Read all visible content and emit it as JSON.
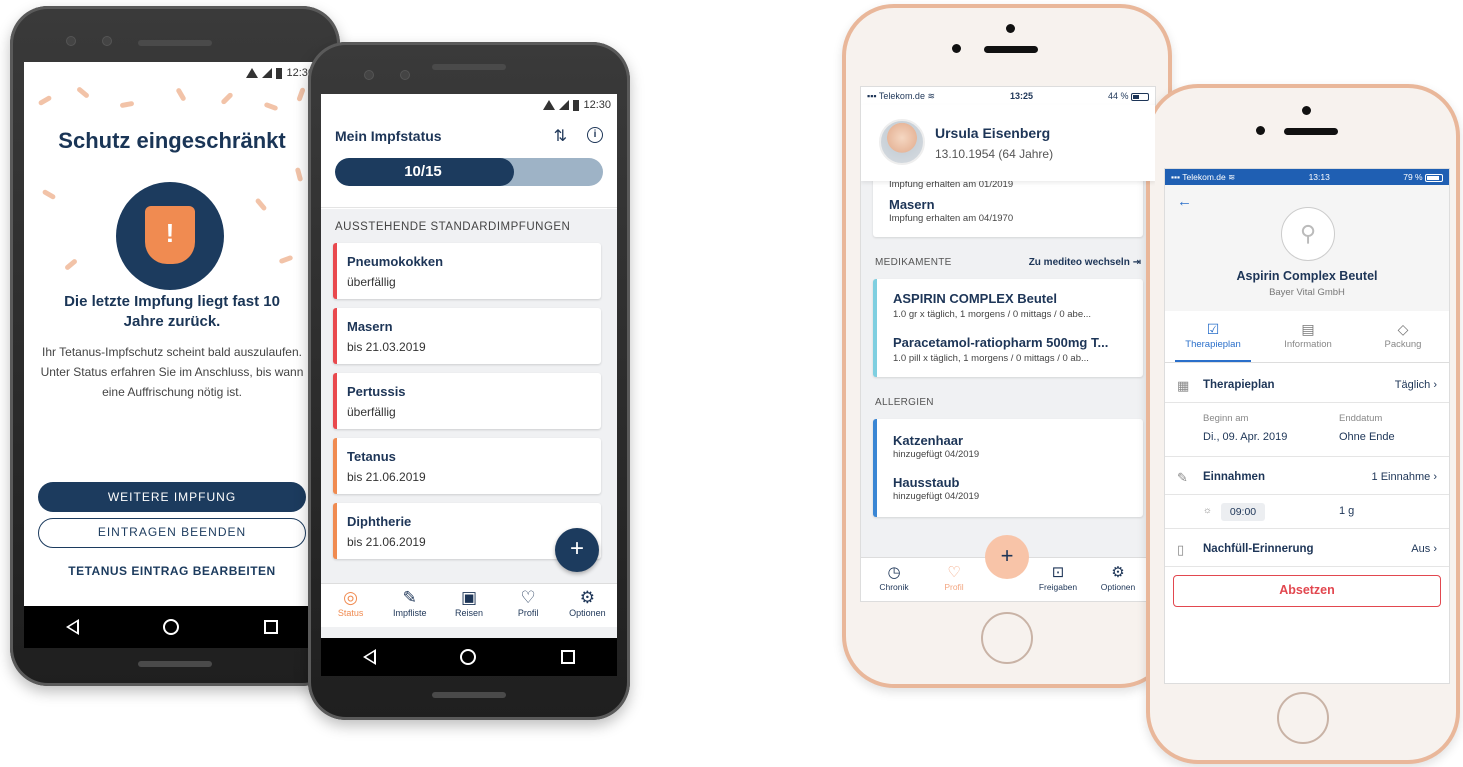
{
  "phone1": {
    "status_time": "12:30",
    "title": "Schutz eingeschränkt",
    "headline": "Die letzte Impfung liegt fast 10 Jahre zurück.",
    "body": "Ihr Tetanus-Impfschutz scheint bald auszulaufen. Unter Status erfahren Sie im Anschluss, bis wann eine Auffrischung nötig ist.",
    "btn_primary": "WEITERE IMPFUNG",
    "btn_secondary": "EINTRAGEN BEENDEN",
    "link": "TETANUS EINTRAG BEARBEITEN",
    "colors": {
      "navy": "#1c3b5e",
      "orange": "#f08b51"
    }
  },
  "phone2": {
    "status_time": "12:30",
    "title": "Mein Impfstatus",
    "progress_text": "10/15",
    "progress_done": 10,
    "progress_total": 15,
    "section": "AUSSTEHENDE STANDARDIMPFUNGEN",
    "vaccines": [
      {
        "name": "Pneumokokken",
        "status": "überfällig"
      },
      {
        "name": "Masern",
        "status": "bis 21.03.2019"
      },
      {
        "name": "Pertussis",
        "status": "überfällig"
      },
      {
        "name": "Tetanus",
        "status": "bis 21.06.2019"
      },
      {
        "name": "Diphtherie",
        "status": "bis 21.06.2019"
      }
    ],
    "tabs": [
      "Status",
      "Impfliste",
      "Reisen",
      "Profil",
      "Optionen"
    ],
    "fab": "+"
  },
  "iphone1": {
    "carrier": "Telekom.de",
    "time": "13:25",
    "battery": "44 %",
    "user_name": "Ursula Eisenberg",
    "user_dob": "13.10.1954 (64 Jahre)",
    "vacc_prev_sub": "Impfung erhalten am 01/2019",
    "vacc_name": "Masern",
    "vacc_sub": "Impfung erhalten am 04/1970",
    "med_section": "MEDIKAMENTE",
    "med_link": "Zu mediteo wechseln",
    "meds": [
      {
        "name": "ASPIRIN COMPLEX Beutel",
        "dose": "1.0 gr x täglich, 1 morgens / 0 mittags / 0 abe..."
      },
      {
        "name": "Paracetamol-ratiopharm 500mg T...",
        "dose": "1.0 pill x täglich, 1 morgens / 0 mittags / 0 ab..."
      }
    ],
    "allergy_section": "ALLERGIEN",
    "allergies": [
      {
        "name": "Katzenhaar",
        "sub": "hinzugefügt 04/2019"
      },
      {
        "name": "Hausstaub",
        "sub": "hinzugefügt 04/2019"
      }
    ],
    "tabs": [
      "Chronik",
      "Profil",
      "Freigaben",
      "Optionen"
    ],
    "fab": "+"
  },
  "iphone2": {
    "carrier": "Telekom.de",
    "time": "13:13",
    "battery": "79 %",
    "product": "Aspirin Complex Beutel",
    "maker": "Bayer Vital GmbH",
    "tabs": [
      "Therapieplan",
      "Information",
      "Packung"
    ],
    "row_plan_label": "Therapieplan",
    "row_plan_value": "Täglich",
    "start_label": "Beginn am",
    "start_value": "Di., 09. Apr. 2019",
    "end_label": "Enddatum",
    "end_value": "Ohne Ende",
    "row_intake_label": "Einnahmen",
    "row_intake_value": "1 Einnahme",
    "intake_time": "09:00",
    "intake_amount": "1 g",
    "row_refill_label": "Nachfüll-Erinnerung",
    "row_refill_value": "Aus",
    "stop_button": "Absetzen"
  }
}
